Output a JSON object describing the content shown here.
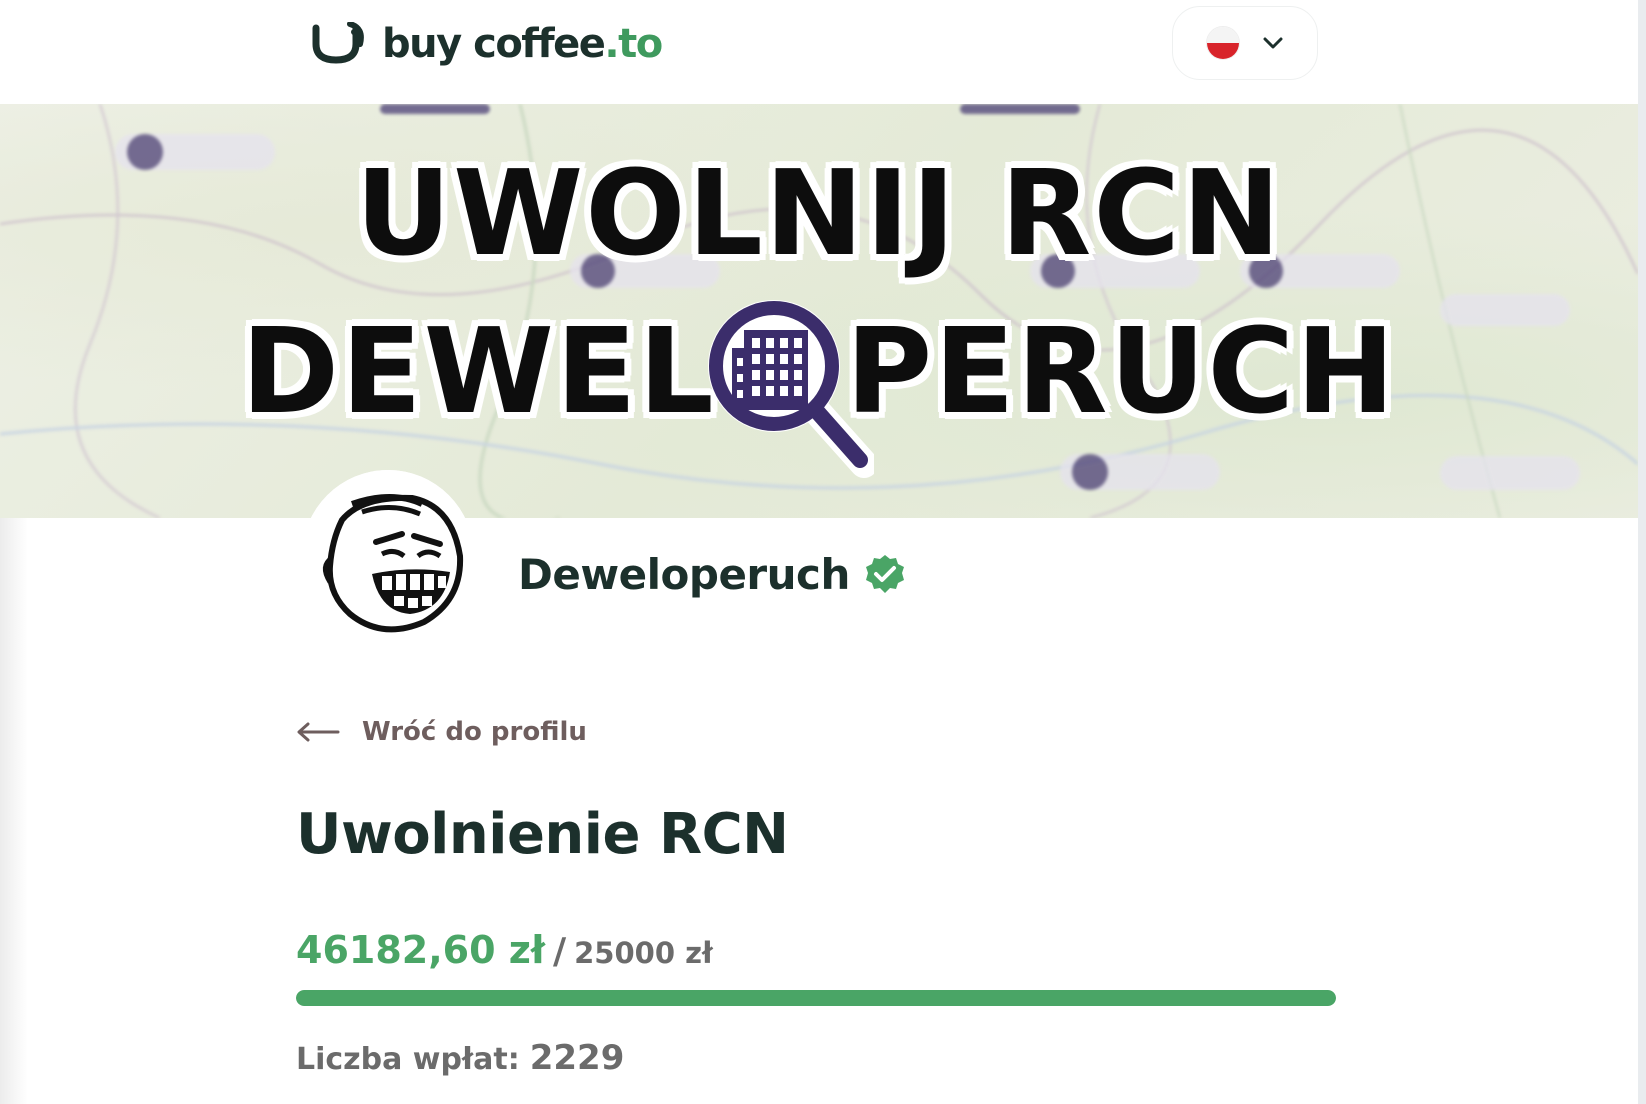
{
  "colors": {
    "brand_dark": "#1c302c",
    "brand_green": "#3f9a5e",
    "progress_green": "#4aa566",
    "muted_text": "#6b6b6b",
    "link_text": "#6e5e5e",
    "verified_badge": "#4aa566",
    "flag_top": "#f4f4f4",
    "flag_bottom": "#d8232a"
  },
  "header": {
    "logo_text_main": "buy coffee",
    "logo_text_accent": ".to",
    "language_flag": "poland-flag-icon"
  },
  "banner": {
    "line1": "UWOLNIJ RCN",
    "line2_left": "DEWEL",
    "line2_right": "PERUCH",
    "emblem": "magnifier-building-icon"
  },
  "profile": {
    "name": "Deweloperuch",
    "verified": true,
    "avatar": "trollface-avatar"
  },
  "back_link": {
    "label": "Wróć do profilu"
  },
  "campaign": {
    "title": "Uwolnienie RCN",
    "raised": "46182,60 zł",
    "separator": "/",
    "goal": "25000 zł",
    "progress_fraction": 1.0,
    "contributions_label": "Liczba wpłat:",
    "contributions_count": "2229"
  }
}
